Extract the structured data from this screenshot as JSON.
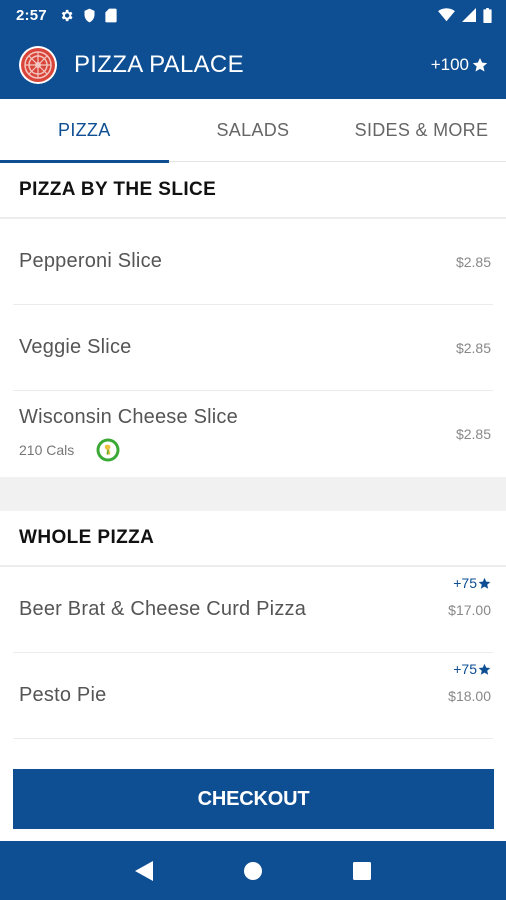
{
  "status_bar": {
    "time": "2:57",
    "left_icons": [
      "gear-icon",
      "shield-icon",
      "sd-card-icon"
    ],
    "right_icons": [
      "wifi-icon",
      "signal-icon",
      "battery-icon"
    ]
  },
  "app_bar": {
    "title": "PIZZA PALACE",
    "points": "+100",
    "logo_icon": "pizza-logo",
    "star_icon": "star-icon",
    "brand_color": "#0e4e93"
  },
  "tabs": [
    {
      "label": "PIZZA",
      "active": true
    },
    {
      "label": "SALADS",
      "active": false
    },
    {
      "label": "SIDES & MORE",
      "active": false
    }
  ],
  "sections": [
    {
      "title": "PIZZA BY THE SLICE",
      "items": [
        {
          "name": "Pepperoni Slice",
          "price": "$2.85"
        },
        {
          "name": "Veggie Slice",
          "price": "$2.85"
        },
        {
          "name": "Wisconsin Cheese Slice",
          "price": "$2.85",
          "calories": "210 Cals",
          "badge": "cheese-badge-icon"
        }
      ]
    },
    {
      "title": "WHOLE PIZZA",
      "items": [
        {
          "name": "Beer Brat & Cheese Curd Pizza",
          "price": "$17.00",
          "points": "+75"
        },
        {
          "name": "Pesto Pie",
          "price": "$18.00",
          "points": "+75"
        }
      ]
    }
  ],
  "checkout": {
    "label": "CHECKOUT"
  },
  "nav_bar": {
    "icons": [
      "back-icon",
      "home-icon",
      "recents-icon"
    ]
  }
}
